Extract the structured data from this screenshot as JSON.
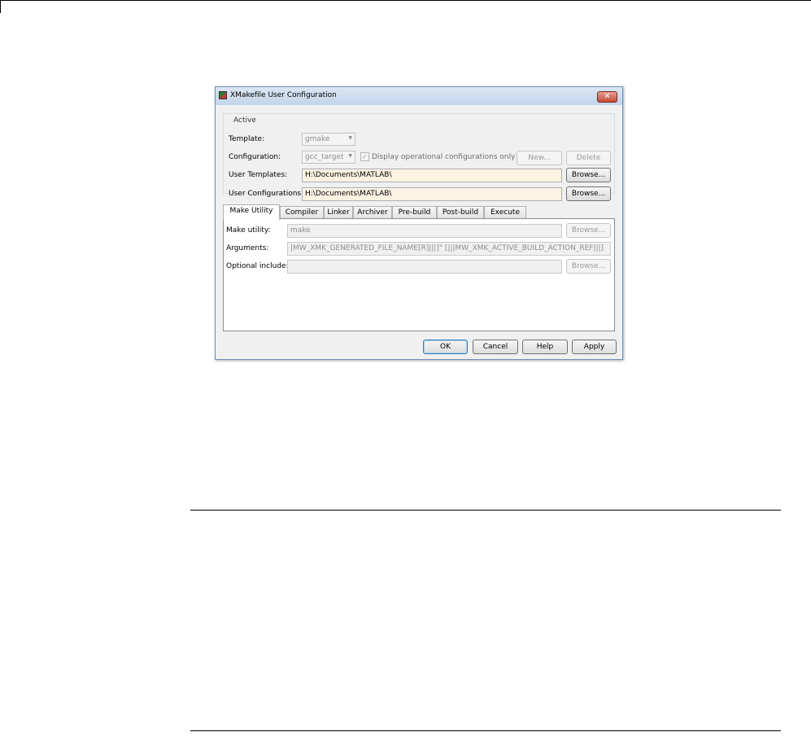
{
  "dialog": {
    "title": "XMakefile User Configuration",
    "close_glyph": "✕"
  },
  "active_group": {
    "label": "Active",
    "template_label": "Template:",
    "template_value": "gmake",
    "configuration_label": "Configuration:",
    "configuration_value": "gcc_target",
    "display_operational_label": "Display operational configurations only",
    "display_operational_checked": true,
    "new_button": "New...",
    "delete_button": "Delete",
    "user_templates_label": "User Templates:",
    "user_templates_value": "H:\\Documents\\MATLAB\\",
    "user_configurations_label": "User Configurations:",
    "user_configurations_value": "H:\\Documents\\MATLAB\\",
    "browse_button": "Browse..."
  },
  "tabs": [
    {
      "label": "Make Utility",
      "active": true
    },
    {
      "label": "Compiler",
      "active": false
    },
    {
      "label": "Linker",
      "active": false
    },
    {
      "label": "Archiver",
      "active": false
    },
    {
      "label": "Pre-build",
      "active": false
    },
    {
      "label": "Post-build",
      "active": false
    },
    {
      "label": "Execute",
      "active": false
    }
  ],
  "make_utility": {
    "make_utility_label": "Make utility:",
    "make_utility_value": "make",
    "arguments_label": "Arguments:",
    "arguments_value": "|MW_XMK_GENERATED_FILE_NAME[R]|||]\" [|||MW_XMK_ACTIVE_BUILD_ACTION_REF|||]",
    "optional_include_label": "Optional include:",
    "optional_include_value": "",
    "browse_button": "Browse..."
  },
  "footer": {
    "ok": "OK",
    "cancel": "Cancel",
    "help": "Help",
    "apply": "Apply"
  }
}
